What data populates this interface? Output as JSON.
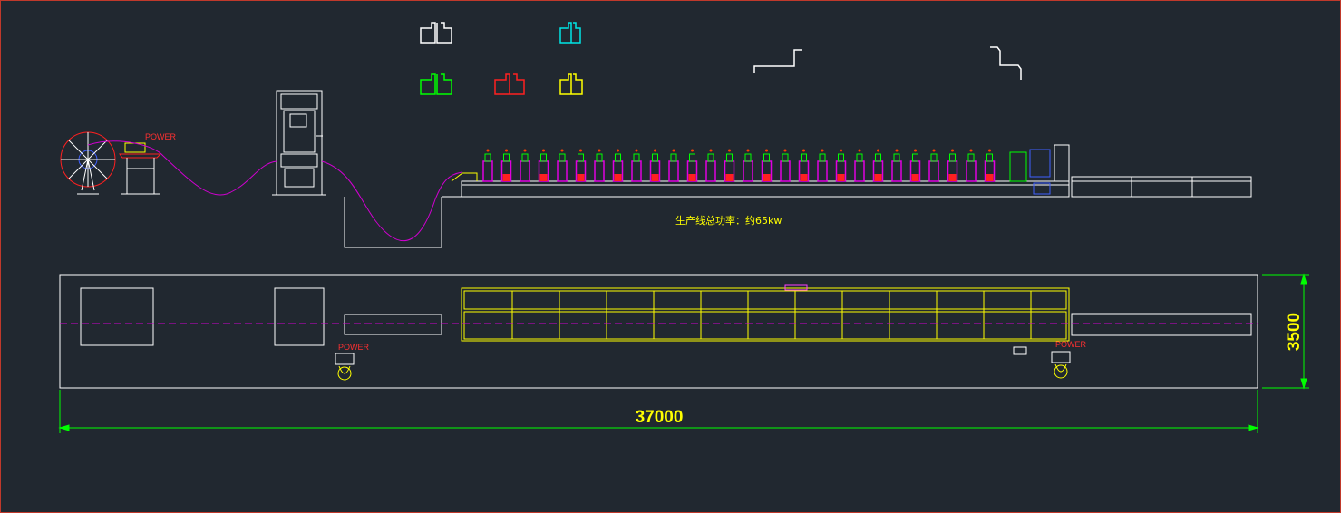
{
  "drawing": {
    "power_label_elevation": "POWER",
    "power_label_plan_left": "POWER",
    "power_label_plan_right": "POWER",
    "total_power_note": "生产线总功率：约65kw",
    "dim_length": "37000",
    "dim_width": "3500"
  },
  "profiles": [
    {
      "name": "profile-white",
      "color": "#ffffff"
    },
    {
      "name": "profile-cyan",
      "color": "#00e5e5"
    },
    {
      "name": "profile-green",
      "color": "#00ff00"
    },
    {
      "name": "profile-red",
      "color": "#ff2020"
    },
    {
      "name": "profile-yellow",
      "color": "#ffff00"
    }
  ],
  "colors": {
    "background": "#212830",
    "frame": "#c0392b",
    "line": "#ffffff",
    "dimension": "#00ff00",
    "material_path": "#d000d0",
    "roller_stand": "#e000e0",
    "roller_red": "#ff2020",
    "plan_frame": "#ffff00"
  }
}
